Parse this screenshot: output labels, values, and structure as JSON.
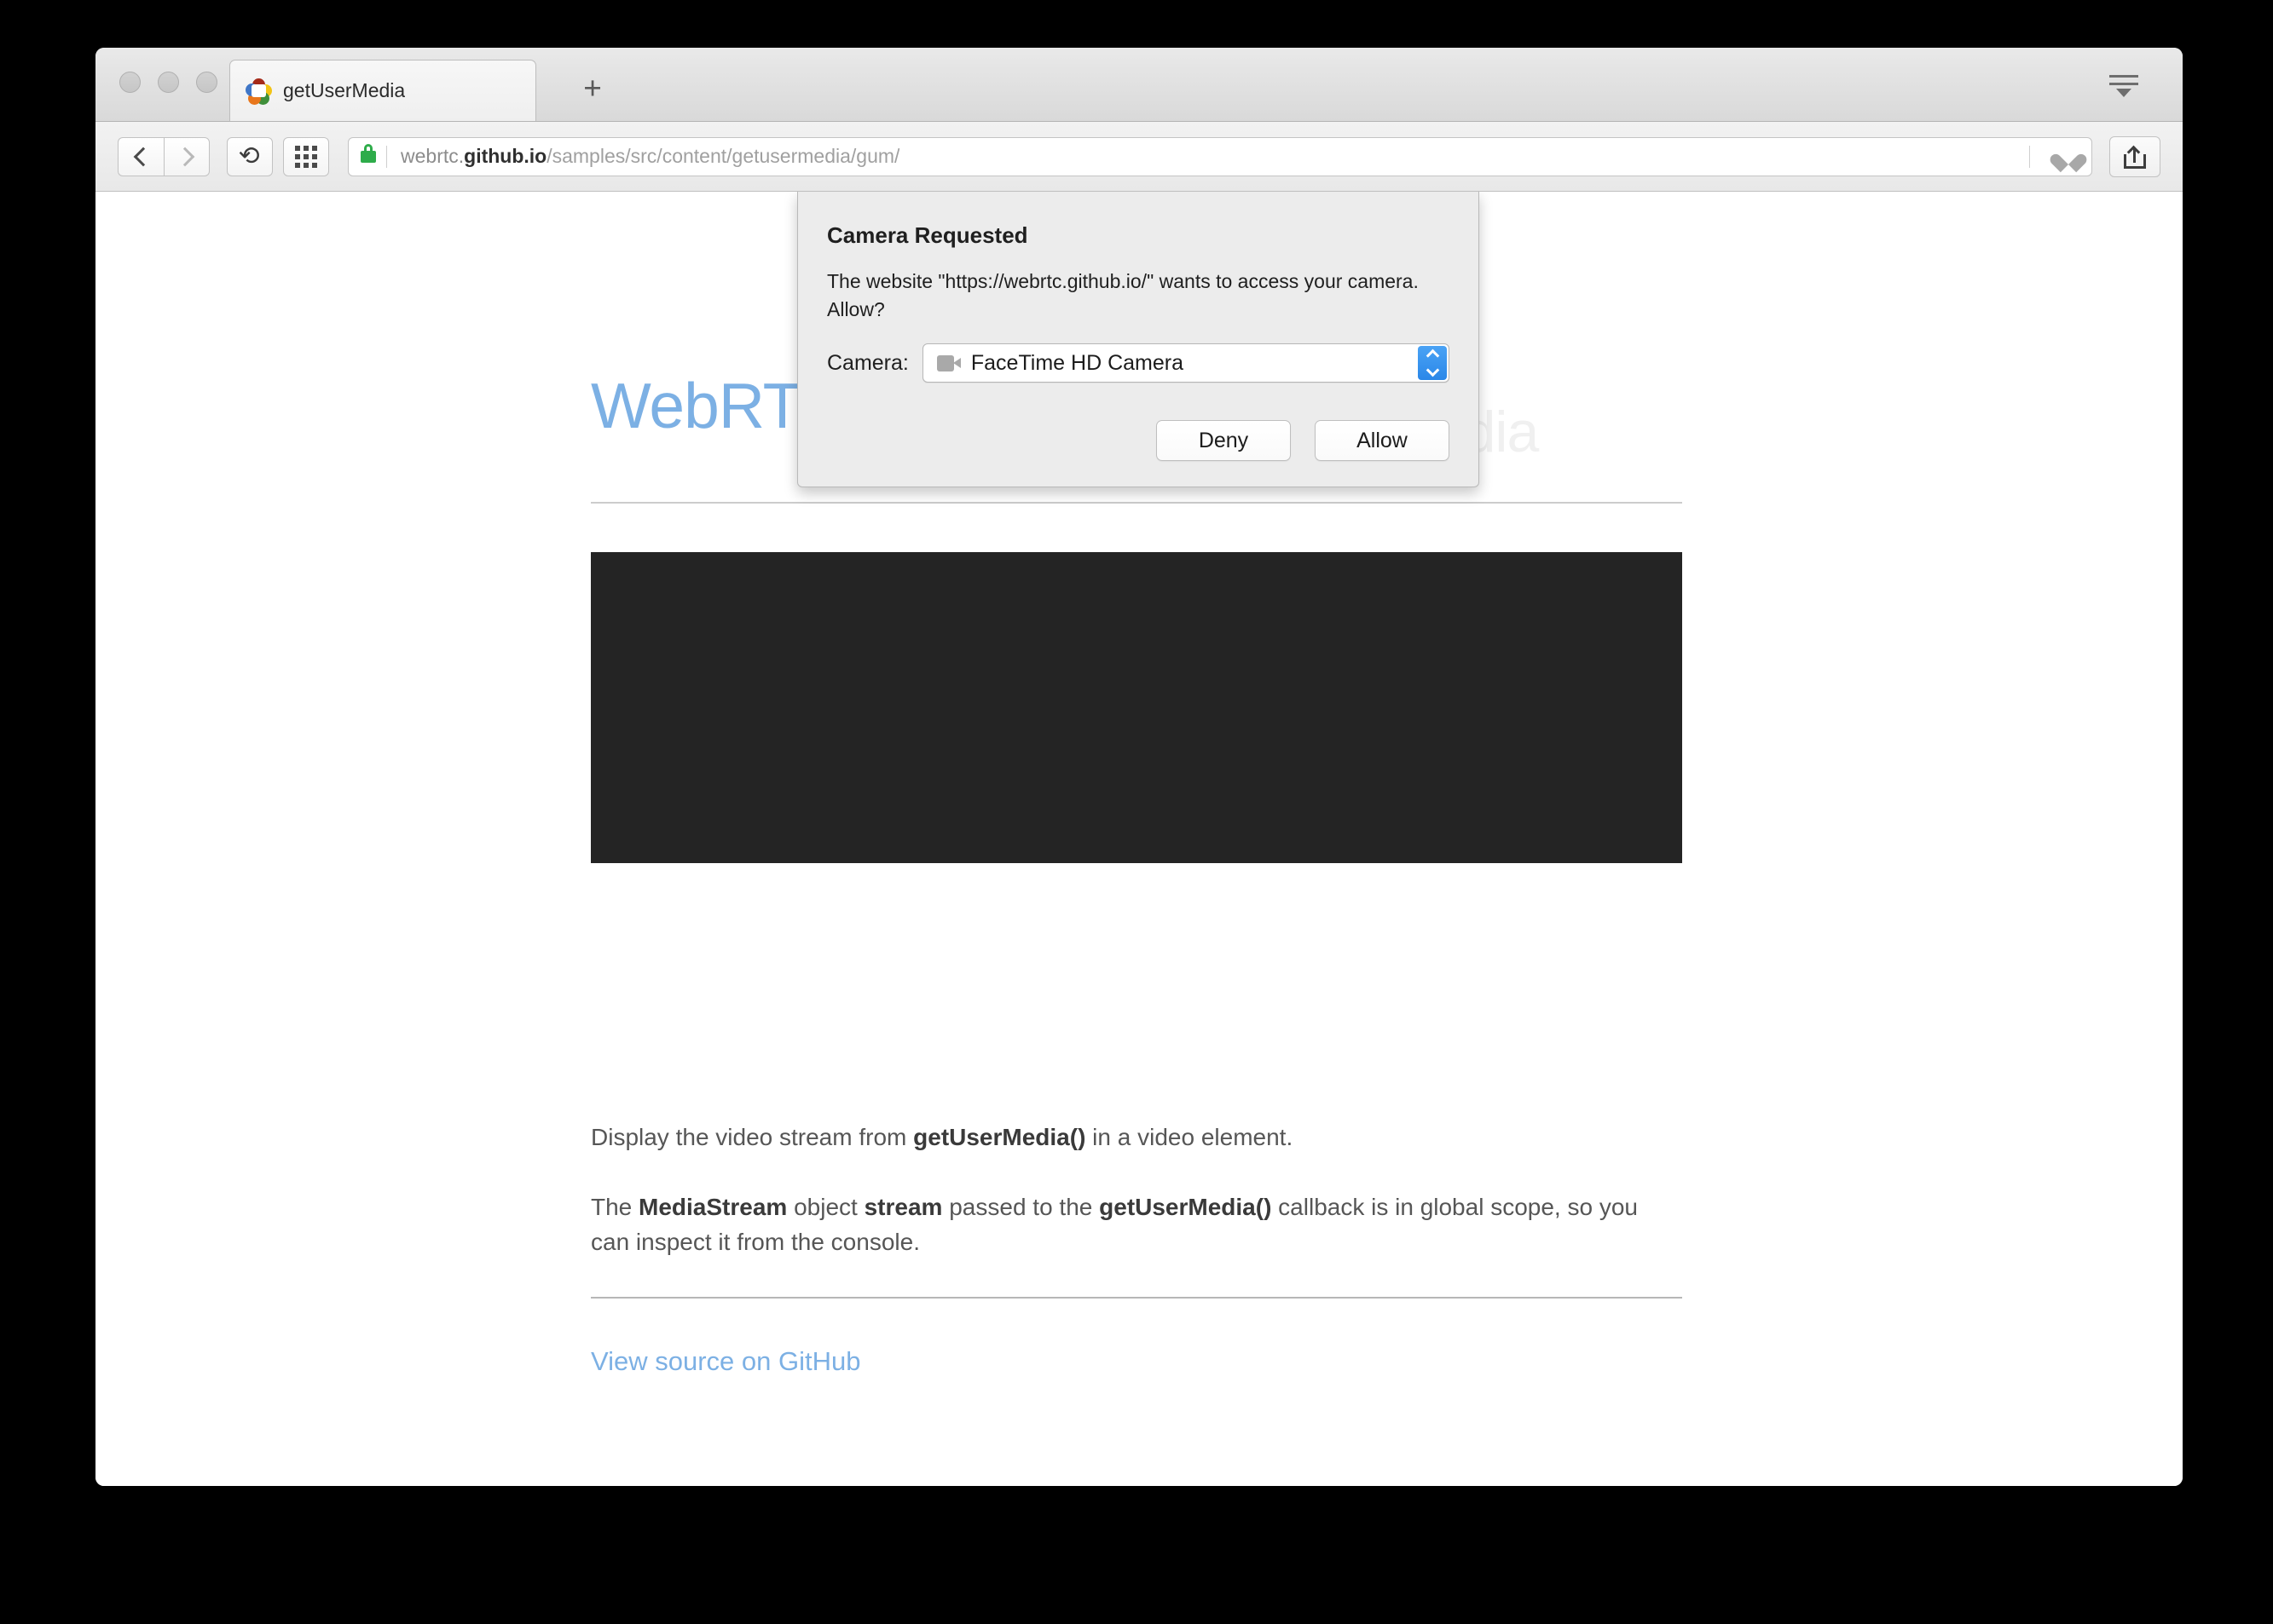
{
  "browser": {
    "window_controls": [
      "close",
      "minimize",
      "zoom"
    ],
    "tab": {
      "title": "getUserMedia",
      "favicon": "webrtc-logo-icon"
    },
    "new_tab_label": "+",
    "tab_overview_icon": "tab-overview-icon",
    "toolbar": {
      "back_icon": "chevron-left-icon",
      "forward_icon": "chevron-right-icon",
      "reload_icon": "reload-icon",
      "apps_icon": "grid-icon",
      "share_icon": "share-icon",
      "favorite_icon": "heart-icon",
      "lock_icon": "lock-icon"
    },
    "address_bar": {
      "url_prefix": "webrtc.",
      "url_domain": "github.io",
      "url_path": "/samples/src/content/getusermedia/gum/",
      "full_url": "webrtc.github.io/samples/src/content/getusermedia/gum/",
      "secure": true
    }
  },
  "page": {
    "watermark": "getUserMedia",
    "heading": "WebRTC samples",
    "video_placeholder": "video-element",
    "paragraphs": [
      {
        "parts": [
          {
            "text": "Display the video stream from ",
            "bold": false
          },
          {
            "text": "getUserMedia()",
            "bold": true
          },
          {
            "text": " in a video element.",
            "bold": false
          }
        ]
      },
      {
        "parts": [
          {
            "text": "The ",
            "bold": false
          },
          {
            "text": "MediaStream",
            "bold": true
          },
          {
            "text": " object ",
            "bold": false
          },
          {
            "text": "stream",
            "bold": true
          },
          {
            "text": " passed to the ",
            "bold": false
          },
          {
            "text": "getUserMedia()",
            "bold": true
          },
          {
            "text": " callback is in global scope, so you can inspect it from the console.",
            "bold": false
          }
        ]
      }
    ],
    "source_link": "View source on GitHub",
    "colors": {
      "heading": "#7cb0e4",
      "link": "#7cb0e4",
      "video_background": "#242424"
    }
  },
  "dialog": {
    "title": "Camera Requested",
    "message": "The website \"https://webrtc.github.io/\" wants to access your camera. Allow?",
    "camera_label": "Camera:",
    "camera_selected": "FaceTime HD Camera",
    "camera_icon": "camera-icon",
    "stepper_icon": "stepper-up-down-icon",
    "deny_label": "Deny",
    "allow_label": "Allow",
    "accent_color": "#2a87e8",
    "background_color": "#ececec"
  }
}
